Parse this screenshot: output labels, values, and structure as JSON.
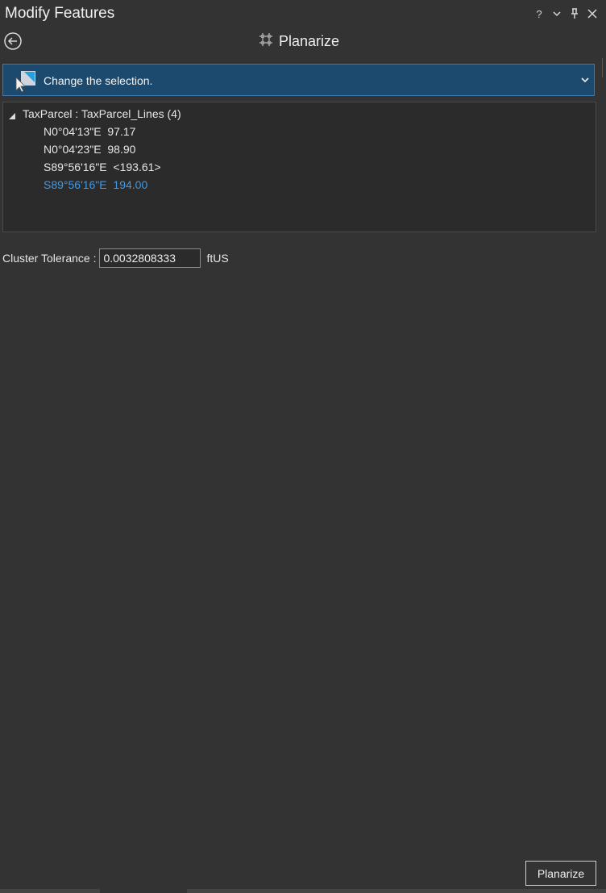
{
  "pane": {
    "title": "Modify Features",
    "controls": {
      "help": "?",
      "options": "options",
      "pin": "pin",
      "close": "close"
    }
  },
  "tool": {
    "title": "Planarize",
    "icon": "planarize-grid-icon"
  },
  "selection": {
    "label": "Change the selection.",
    "icon": "select-features-icon",
    "accent": "#1c4a6e"
  },
  "feature_tree": {
    "root_label": "TaxParcel : TaxParcel_Lines (4)",
    "items": [
      {
        "label": "N0°04'13\"E  97.17",
        "selected": false
      },
      {
        "label": "N0°04'23\"E  98.90",
        "selected": false
      },
      {
        "label": "S89°56'16\"E  <193.61>",
        "selected": false
      },
      {
        "label": "S89°56'16\"E  194.00",
        "selected": true
      }
    ],
    "selected_color": "#3d9ae8"
  },
  "cluster_tolerance": {
    "label": "Cluster Tolerance :",
    "value": "0.0032808333",
    "unit": "ftUS"
  },
  "action": {
    "planarize_label": "Planarize"
  }
}
